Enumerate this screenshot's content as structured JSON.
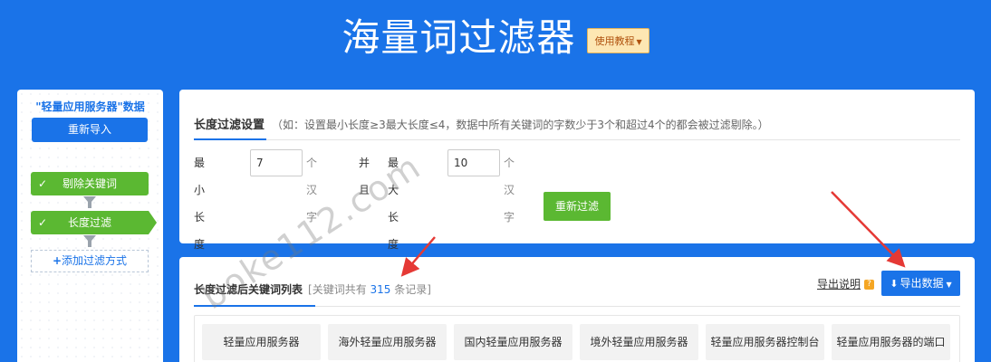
{
  "header": {
    "title": "海量词过滤器",
    "tutorial_label": "使用教程"
  },
  "sidebar": {
    "title": "\"轻量应用服务器\"数据",
    "reimport_label": "重新导入",
    "steps": [
      {
        "label": "剔除关键词",
        "checked": true
      },
      {
        "label": "长度过滤",
        "checked": true,
        "active": true
      }
    ],
    "check_glyph": "✓",
    "add_filter_label": "添加过滤方式"
  },
  "length_filter": {
    "title": "长度过滤设置",
    "hint": "（如：设置最小长度≥3最大长度≤4，数据中所有关键词的字数少于3个和超过4个的都会被过滤剔除。）",
    "min_label": "最小长度 ≥",
    "min_value": "7",
    "min_unit": "个汉字",
    "and_label": "并且",
    "max_label": "最大长度 ≤",
    "max_value": "10",
    "max_unit": "个汉字",
    "refilter_label": "重新过滤"
  },
  "results": {
    "title": "长度过滤后关键词列表",
    "count_prefix": "[关键词共有",
    "count": "315",
    "count_suffix": "条记录]",
    "export_help_label": "导出说明",
    "help_badge": "?",
    "export_label": "导出数据",
    "keywords": [
      "轻量应用服务器",
      "海外轻量应用服务器",
      "国内轻量应用服务器",
      "境外轻量应用服务器",
      "轻量应用服务器控制台",
      "轻量应用服务器的端口"
    ]
  },
  "watermark": "boke112.com",
  "colors": {
    "background": "#1a73e8",
    "primary": "#1a73e8",
    "success": "#5bb832",
    "tutorial_bg": "#fde7b3",
    "annotation_arrow": "#e53935"
  }
}
